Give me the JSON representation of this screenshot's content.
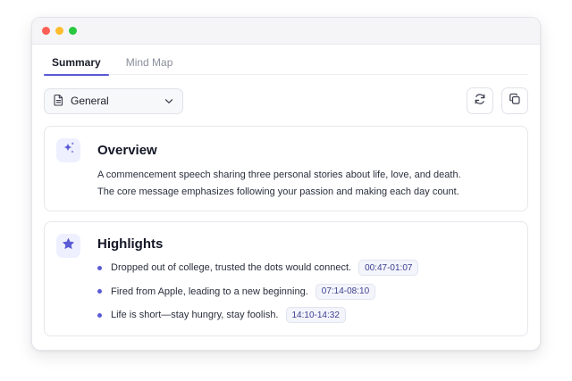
{
  "window": {
    "controls": [
      {
        "name": "close",
        "color": "#ff5f57"
      },
      {
        "name": "minimize",
        "color": "#febc2e"
      },
      {
        "name": "zoom",
        "color": "#28c840"
      }
    ]
  },
  "tabs": [
    {
      "label": "Summary",
      "active": true
    },
    {
      "label": "Mind Map",
      "active": false
    }
  ],
  "toolbar": {
    "select_value": "General",
    "select_icon": "document-icon",
    "refresh_icon": "refresh-icon",
    "copy_icon": "copy-icon"
  },
  "overview": {
    "icon": "sparkles-icon",
    "title": "Overview",
    "lines": [
      "A commencement speech sharing three personal stories about life, love, and death.",
      "The core message emphasizes following your passion and making each day count."
    ]
  },
  "highlights": {
    "icon": "star-icon",
    "title": "Highlights",
    "items": [
      {
        "text": "Dropped out of college, trusted the dots would connect.",
        "timestamp": "00:47-01:07"
      },
      {
        "text": "Fired from Apple, leading to a new beginning.",
        "timestamp": "07:14-08:10"
      },
      {
        "text": "Life is short—stay hungry, stay foolish.",
        "timestamp": "14:10-14:32"
      }
    ]
  },
  "colors": {
    "accent": "#5b5bd6",
    "timestamp_text": "#3b3f8f"
  }
}
